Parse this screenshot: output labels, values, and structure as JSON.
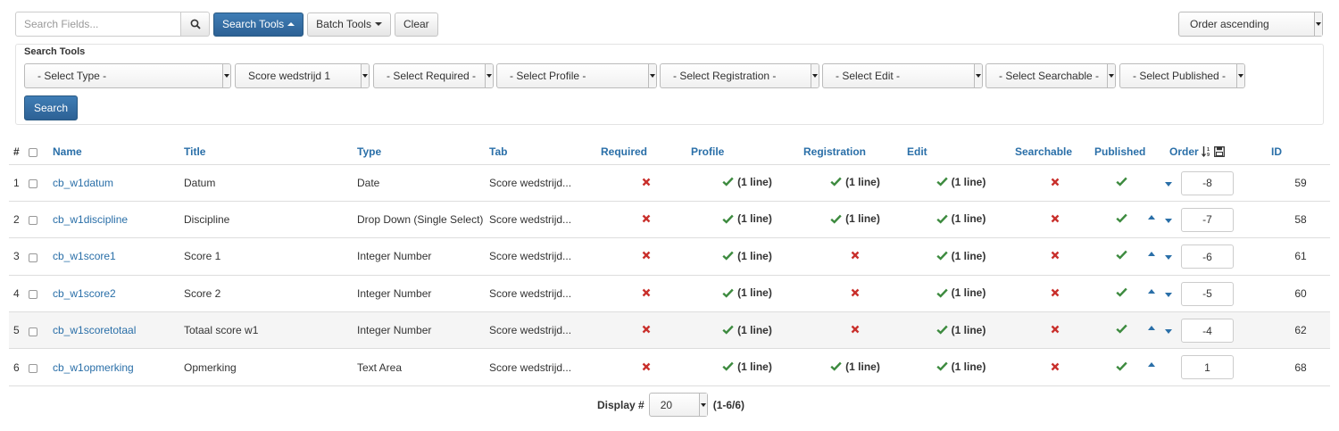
{
  "toolbar": {
    "search_placeholder": "Search Fields...",
    "search_tools_label": "Search Tools",
    "batch_tools_label": "Batch Tools",
    "clear_label": "Clear",
    "order_select": "Order ascending"
  },
  "search_tools": {
    "title": "Search Tools",
    "filters": [
      "- Select Type -",
      "Score wedstrijd 1",
      "- Select Required -",
      "- Select Profile -",
      "- Select Registration -",
      "- Select Edit -",
      "- Select Searchable -",
      "- Select Published -"
    ],
    "search_label": "Search"
  },
  "table": {
    "headers": {
      "hash": "#",
      "name": "Name",
      "title": "Title",
      "type": "Type",
      "tab": "Tab",
      "required": "Required",
      "profile": "Profile",
      "registration": "Registration",
      "edit": "Edit",
      "searchable": "Searchable",
      "published": "Published",
      "order": "Order",
      "id": "ID"
    },
    "rows": [
      {
        "num": "1",
        "name": "cb_w1datum",
        "title": "Datum",
        "type": "Date",
        "tab": "Score wedstrijd...",
        "required": false,
        "profile": "(1 line)",
        "registration": "(1 line)",
        "edit": "(1 line)",
        "searchable": false,
        "published": true,
        "order": "-8",
        "id": "59",
        "up": false,
        "down": true
      },
      {
        "num": "2",
        "name": "cb_w1discipline",
        "title": "Discipline",
        "type": "Drop Down (Single Select)",
        "tab": "Score wedstrijd...",
        "required": false,
        "profile": "(1 line)",
        "registration": "(1 line)",
        "edit": "(1 line)",
        "searchable": false,
        "published": true,
        "order": "-7",
        "id": "58",
        "up": true,
        "down": true
      },
      {
        "num": "3",
        "name": "cb_w1score1",
        "title": "Score 1",
        "type": "Integer Number",
        "tab": "Score wedstrijd...",
        "required": false,
        "profile": "(1 line)",
        "registration": null,
        "edit": "(1 line)",
        "searchable": false,
        "published": true,
        "order": "-6",
        "id": "61",
        "up": true,
        "down": true
      },
      {
        "num": "4",
        "name": "cb_w1score2",
        "title": "Score 2",
        "type": "Integer Number",
        "tab": "Score wedstrijd...",
        "required": false,
        "profile": "(1 line)",
        "registration": null,
        "edit": "(1 line)",
        "searchable": false,
        "published": true,
        "order": "-5",
        "id": "60",
        "up": true,
        "down": true
      },
      {
        "num": "5",
        "name": "cb_w1scoretotaal",
        "title": "Totaal score w1",
        "type": "Integer Number",
        "tab": "Score wedstrijd...",
        "required": false,
        "profile": "(1 line)",
        "registration": null,
        "edit": "(1 line)",
        "searchable": false,
        "published": true,
        "order": "-4",
        "id": "62",
        "up": true,
        "down": true
      },
      {
        "num": "6",
        "name": "cb_w1opmerking",
        "title": "Opmerking",
        "type": "Text Area",
        "tab": "Score wedstrijd...",
        "required": false,
        "profile": "(1 line)",
        "registration": "(1 line)",
        "edit": "(1 line)",
        "searchable": false,
        "published": true,
        "order": "1",
        "id": "68",
        "up": true,
        "down": false
      }
    ]
  },
  "footer": {
    "display_label": "Display #",
    "limit": "20",
    "range": "(1-6/6)"
  },
  "colors": {
    "primary": "#2d6195",
    "link": "#2a6fa8",
    "cross": "#c9302c",
    "check": "#3c8a3e"
  }
}
